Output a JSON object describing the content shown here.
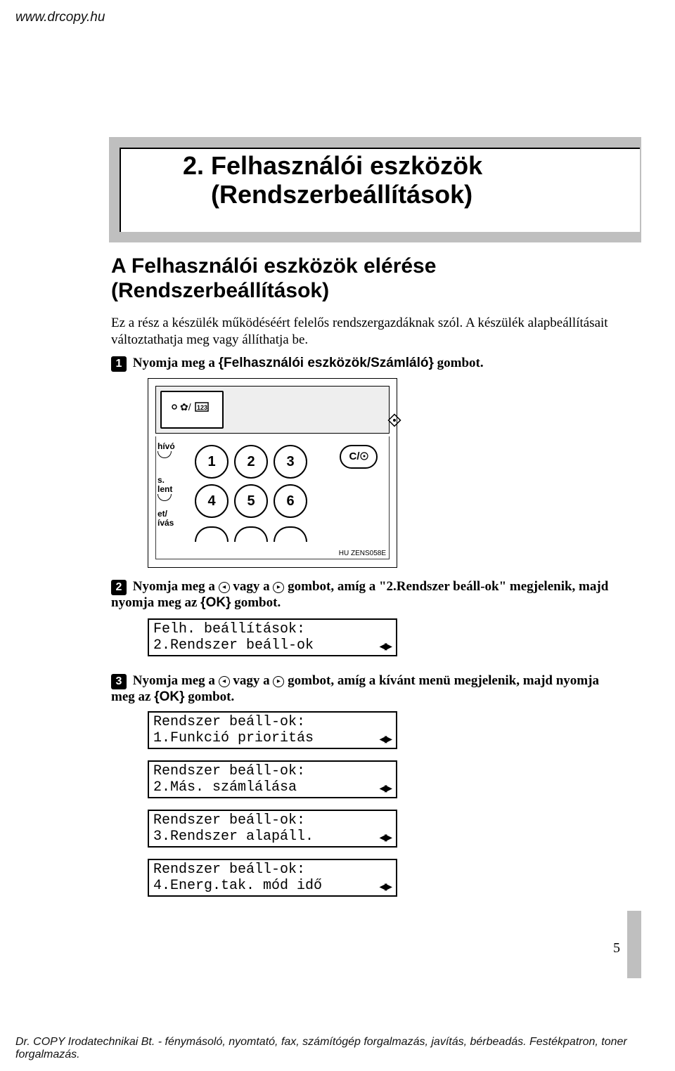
{
  "header": {
    "url": "www.drcopy.hu"
  },
  "chapter": {
    "title_line1": "2. Felhasználói eszközök",
    "title_line2": "(Rendszerbeállítások)"
  },
  "section": {
    "title_line1": "A Felhasználói eszközök elérése",
    "title_line2": "(Rendszerbeállítások)"
  },
  "paragraphs": {
    "p1": "Ez a rész a készülék működéséért felelős rendszergazdáknak szól. A készülék alapbeállításait változtathatja meg vagy állíthatja be."
  },
  "steps": {
    "s1": {
      "num": "1",
      "pre": "Nyomja meg a ",
      "key": "Felhasználói eszközök/Számláló",
      "post": " gombot."
    },
    "s2": {
      "num": "2",
      "pre": "Nyomja meg a ",
      "mid": " vagy a ",
      "mid2": " gombot, amíg a \"2.Rendszer beáll-ok\" megjelenik, majd nyomja meg az ",
      "key": "OK",
      "post": " gombot."
    },
    "s3": {
      "num": "3",
      "pre": " Nyomja meg a ",
      "mid": " vagy a ",
      "mid2": " gombot, amíg a kívánt menü megjelenik, majd nyomja meg az ",
      "key": "OK",
      "post": " gombot."
    }
  },
  "keypad": {
    "side1": "hívó",
    "side2a": "s.",
    "side2b": "lent",
    "side3a": "et/",
    "side3b": "ívás",
    "nums": [
      "1",
      "2",
      "3",
      "4",
      "5",
      "6"
    ],
    "clear": "C/",
    "code": "HU ZENS058E"
  },
  "lcd": {
    "d1l1": "Felh. beállítások:",
    "d1l2": "2.Rendszer beáll-ok",
    "d2l1": "Rendszer beáll-ok:",
    "d2l2": "1.Funkció prioritás",
    "d3l1": "Rendszer beáll-ok:",
    "d3l2": "2.Más. számlálása",
    "d4l1": "Rendszer beáll-ok:",
    "d4l2": "3.Rendszer alapáll.",
    "d5l1": "Rendszer beáll-ok:",
    "d5l2": "4.Energ.tak. mód idő"
  },
  "page_number": "5",
  "footer": "Dr. COPY Irodatechnikai Bt. - fénymásoló, nyomtató, fax, számítógép forgalmazás, javítás, bérbeadás. Festékpatron, toner forgalmazás."
}
